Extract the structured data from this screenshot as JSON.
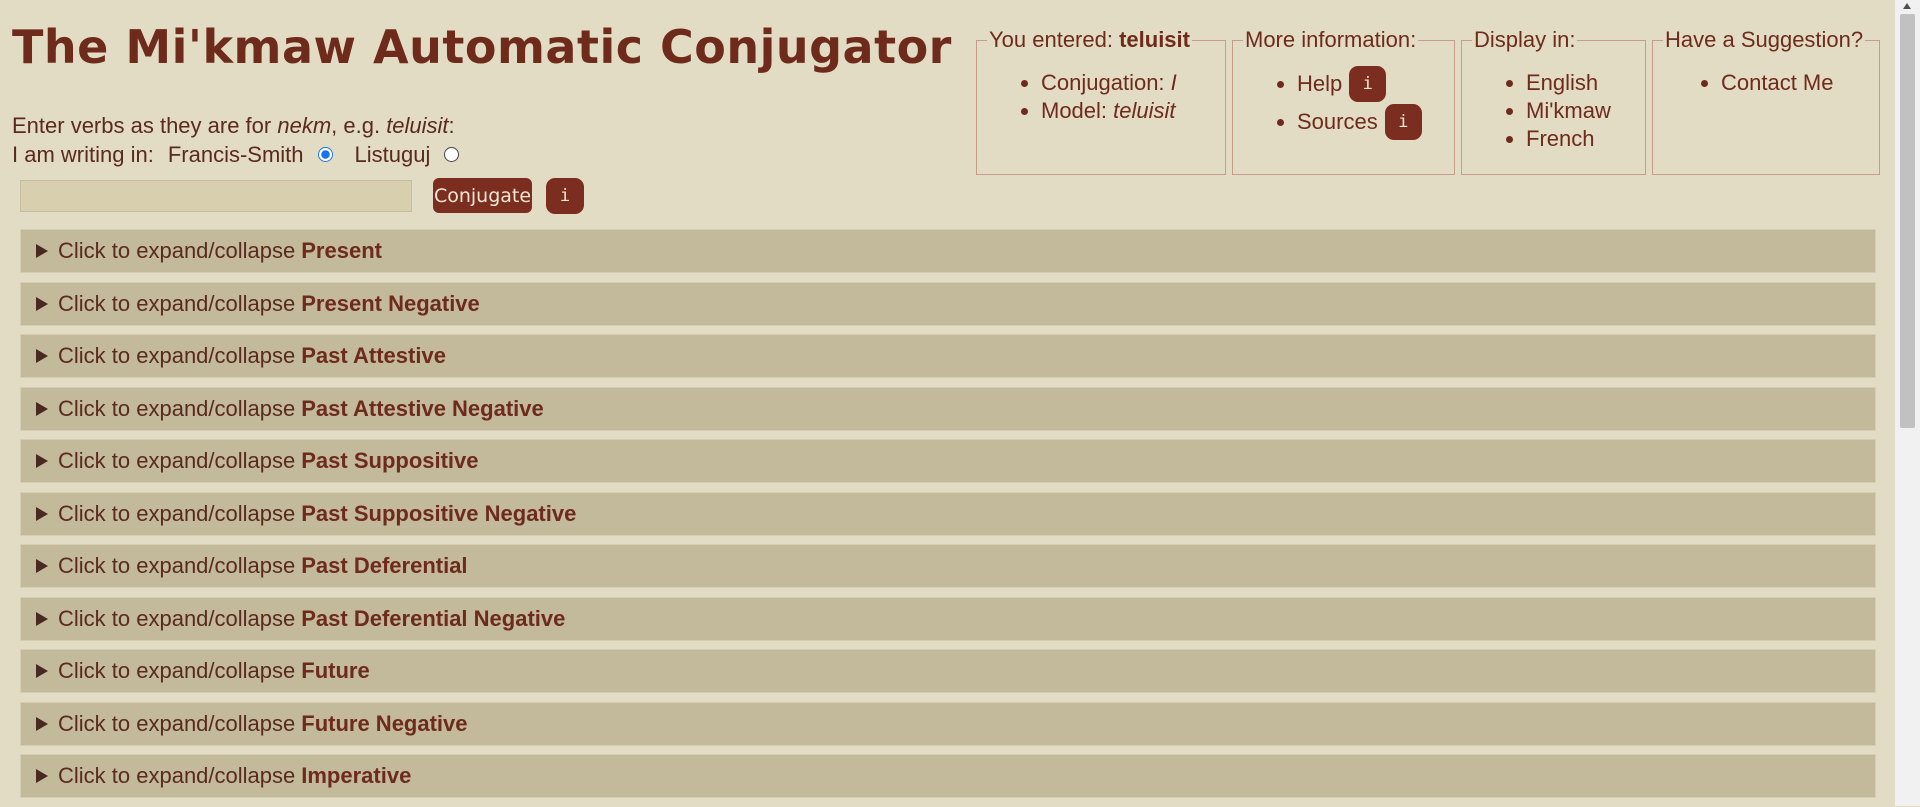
{
  "title": "The Mi'kmaw Automatic Conjugator",
  "instructions": {
    "prefix": "Enter verbs as they are for ",
    "nekm": "nekm",
    "mid": ", e.g. ",
    "example": "teluisit",
    "suffix": ":",
    "writing_label": "I am writing in:",
    "options": [
      {
        "label": "Francis-Smith",
        "checked": true
      },
      {
        "label": "Listuguj",
        "checked": false
      }
    ]
  },
  "input": {
    "value": "",
    "placeholder": ""
  },
  "conjugate_label": "Conjugate",
  "info_glyph": "i",
  "entered": {
    "legend_prefix": "You entered: ",
    "verb": "teluisit",
    "conjugation_label": "Conjugation: ",
    "conjugation_value": "I",
    "model_label": "Model: ",
    "model_value": "teluisit"
  },
  "more_info": {
    "legend": "More information:",
    "help": "Help",
    "sources": "Sources"
  },
  "display_in": {
    "legend": "Display in:",
    "items": [
      "English",
      "Mi'kmaw",
      "French"
    ]
  },
  "suggestion": {
    "legend": "Have a Suggestion?",
    "contact": "Contact Me"
  },
  "section_prefix": "Click to expand/collapse",
  "sections": [
    "Present",
    "Present Negative",
    "Past Attestive",
    "Past Attestive Negative",
    "Past Suppositive",
    "Past Suppositive Negative",
    "Past Deferential",
    "Past Deferential Negative",
    "Future",
    "Future Negative",
    "Imperative"
  ],
  "colors": {
    "background": "#e3dcc4",
    "accent": "#7b2e20",
    "text": "#6e2b1c",
    "section_bg": "#c3b99b"
  }
}
